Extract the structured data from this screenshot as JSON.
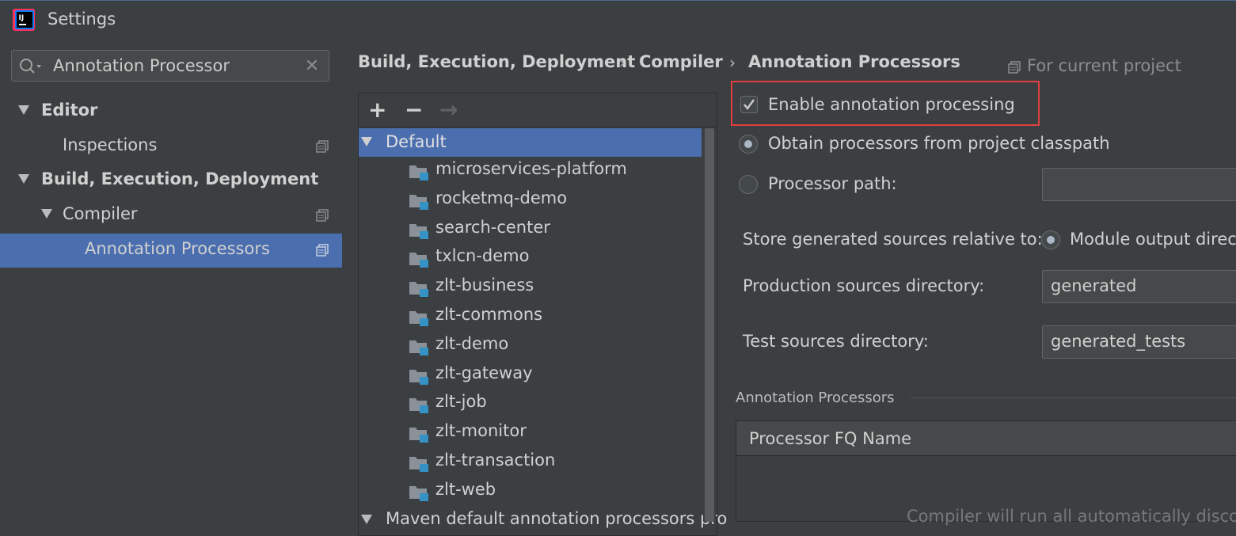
{
  "window": {
    "title": "Settings"
  },
  "search": {
    "value": "Annotation Processor"
  },
  "sidebar": {
    "items": [
      {
        "label": "Editor"
      },
      {
        "label": "Inspections"
      },
      {
        "label": "Build, Execution, Deployment"
      },
      {
        "label": "Compiler"
      },
      {
        "label": "Annotation Processors"
      }
    ]
  },
  "breadcrumb": {
    "items": [
      "Build, Execution, Deployment",
      "Compiler",
      "Annotation Processors"
    ],
    "separator": "›",
    "scope_label": "For current project"
  },
  "tree": {
    "toolbar": {
      "add": "+",
      "remove": "−",
      "move": "→"
    },
    "default_label": "Default",
    "modules": [
      "microservices-platform",
      "rocketmq-demo",
      "search-center",
      "txlcn-demo",
      "zlt-business",
      "zlt-commons",
      "zlt-demo",
      "zlt-gateway",
      "zlt-job",
      "zlt-monitor",
      "zlt-transaction",
      "zlt-web"
    ],
    "maven_label": "Maven default annotation processors pro"
  },
  "settings": {
    "enable_label": "Enable annotation processing",
    "enable_checked": true,
    "obtain_label": "Obtain processors from project classpath",
    "processor_path_label": "Processor path:",
    "store_label": "Store generated sources relative to:",
    "module_output_label": "Module output direct",
    "production_label": "Production sources directory:",
    "production_value": "generated",
    "test_label": "Test sources directory:",
    "test_value": "generated_tests",
    "section_title": "Annotation Processors",
    "table_header": "Processor FQ Name",
    "empty_text": "Compiler will run all automatically discov"
  },
  "colors": {
    "background": "#3c3f41",
    "selection": "#4b6eaf",
    "highlight_border": "#e0403e",
    "folder_badge": "#3592c4"
  }
}
